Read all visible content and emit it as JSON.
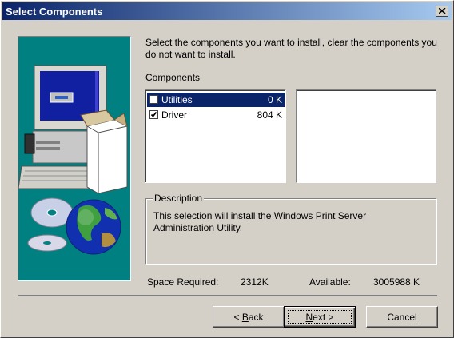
{
  "window": {
    "title": "Select Components"
  },
  "instruction": "Select the components you want to install, clear the components you do not want to install.",
  "components": {
    "label_underlined": "C",
    "label_rest": "omponents",
    "items": [
      {
        "name": "Utilities",
        "size": "0 K",
        "checked": false,
        "selected": true
      },
      {
        "name": "Driver",
        "size": "804 K",
        "checked": true,
        "selected": false
      }
    ]
  },
  "description": {
    "legend": "Description",
    "text": "This selection will install the Windows Print Server Administration Utility."
  },
  "space": {
    "required_label": "Space Required:",
    "required_value": "2312K",
    "available_label": "Available:",
    "available_value": "3005988 K"
  },
  "buttons": {
    "back_prefix": "< ",
    "back_underlined": "B",
    "back_rest": "ack",
    "next_underlined": "N",
    "next_rest": "ext >",
    "cancel": "Cancel"
  },
  "colors": {
    "titlebar_start": "#0a246a",
    "titlebar_end": "#a6caf0",
    "art_background": "#008080",
    "selection": "#0a246a",
    "face": "#d4d0c8"
  },
  "icons": {
    "close": "close-icon",
    "check": "checkmark-icon",
    "art_computer": "computer-illustration",
    "art_globe": "globe-illustration",
    "art_discs": "cd-discs-illustration"
  }
}
